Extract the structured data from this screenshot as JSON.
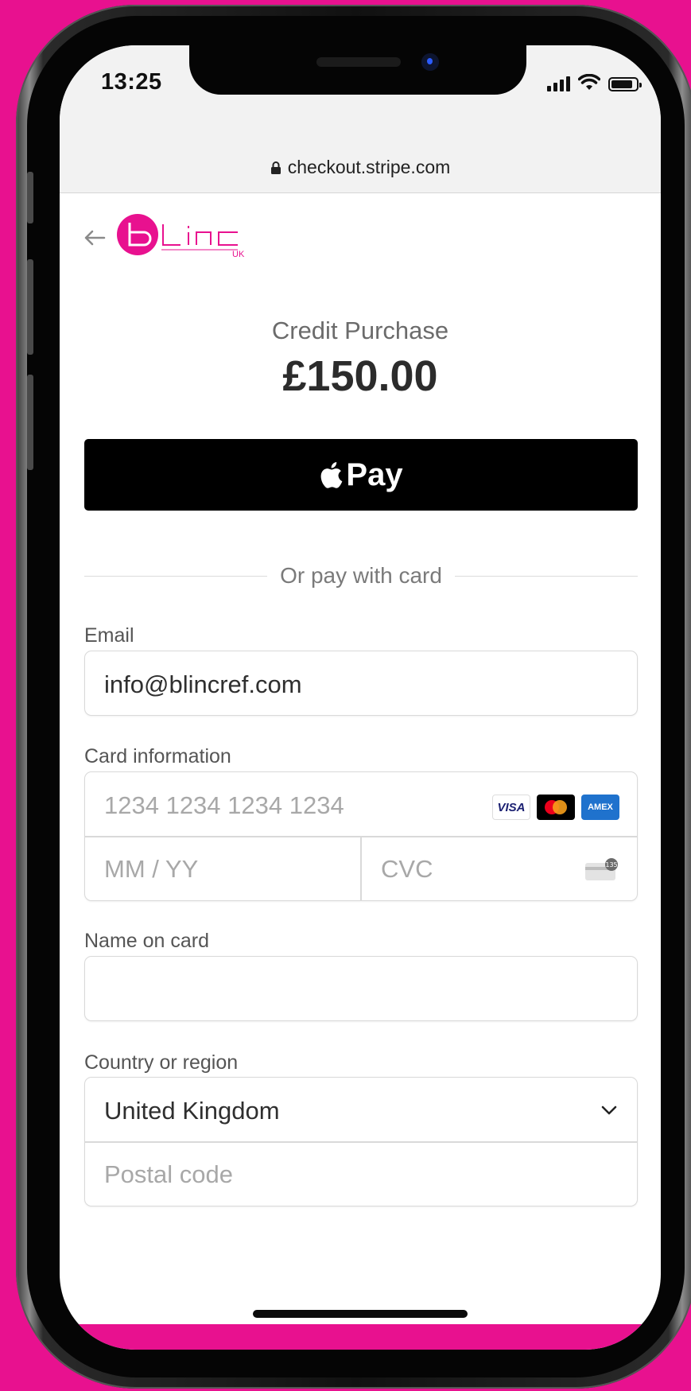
{
  "status_bar": {
    "time": "13:25"
  },
  "browser": {
    "url": "checkout.stripe.com"
  },
  "merchant": {
    "logo_text": "blinc",
    "logo_sub": "UK"
  },
  "order": {
    "product": "Credit Purchase",
    "price": "£150.00"
  },
  "apple_pay": {
    "label": "Pay"
  },
  "divider": {
    "text": "Or pay with card"
  },
  "email": {
    "label": "Email",
    "value": "info@blincref.com"
  },
  "card": {
    "label": "Card information",
    "number_placeholder": "1234 1234 1234 1234",
    "expiry_placeholder": "MM / YY",
    "cvc_placeholder": "CVC",
    "brands": [
      "VISA",
      "AMEX"
    ]
  },
  "name": {
    "label": "Name on card",
    "value": ""
  },
  "country": {
    "label": "Country or region",
    "value": "United Kingdom",
    "postal_placeholder": "Postal code"
  },
  "colors": {
    "brand": "#e8118f",
    "apple_pay_bg": "#000000"
  }
}
